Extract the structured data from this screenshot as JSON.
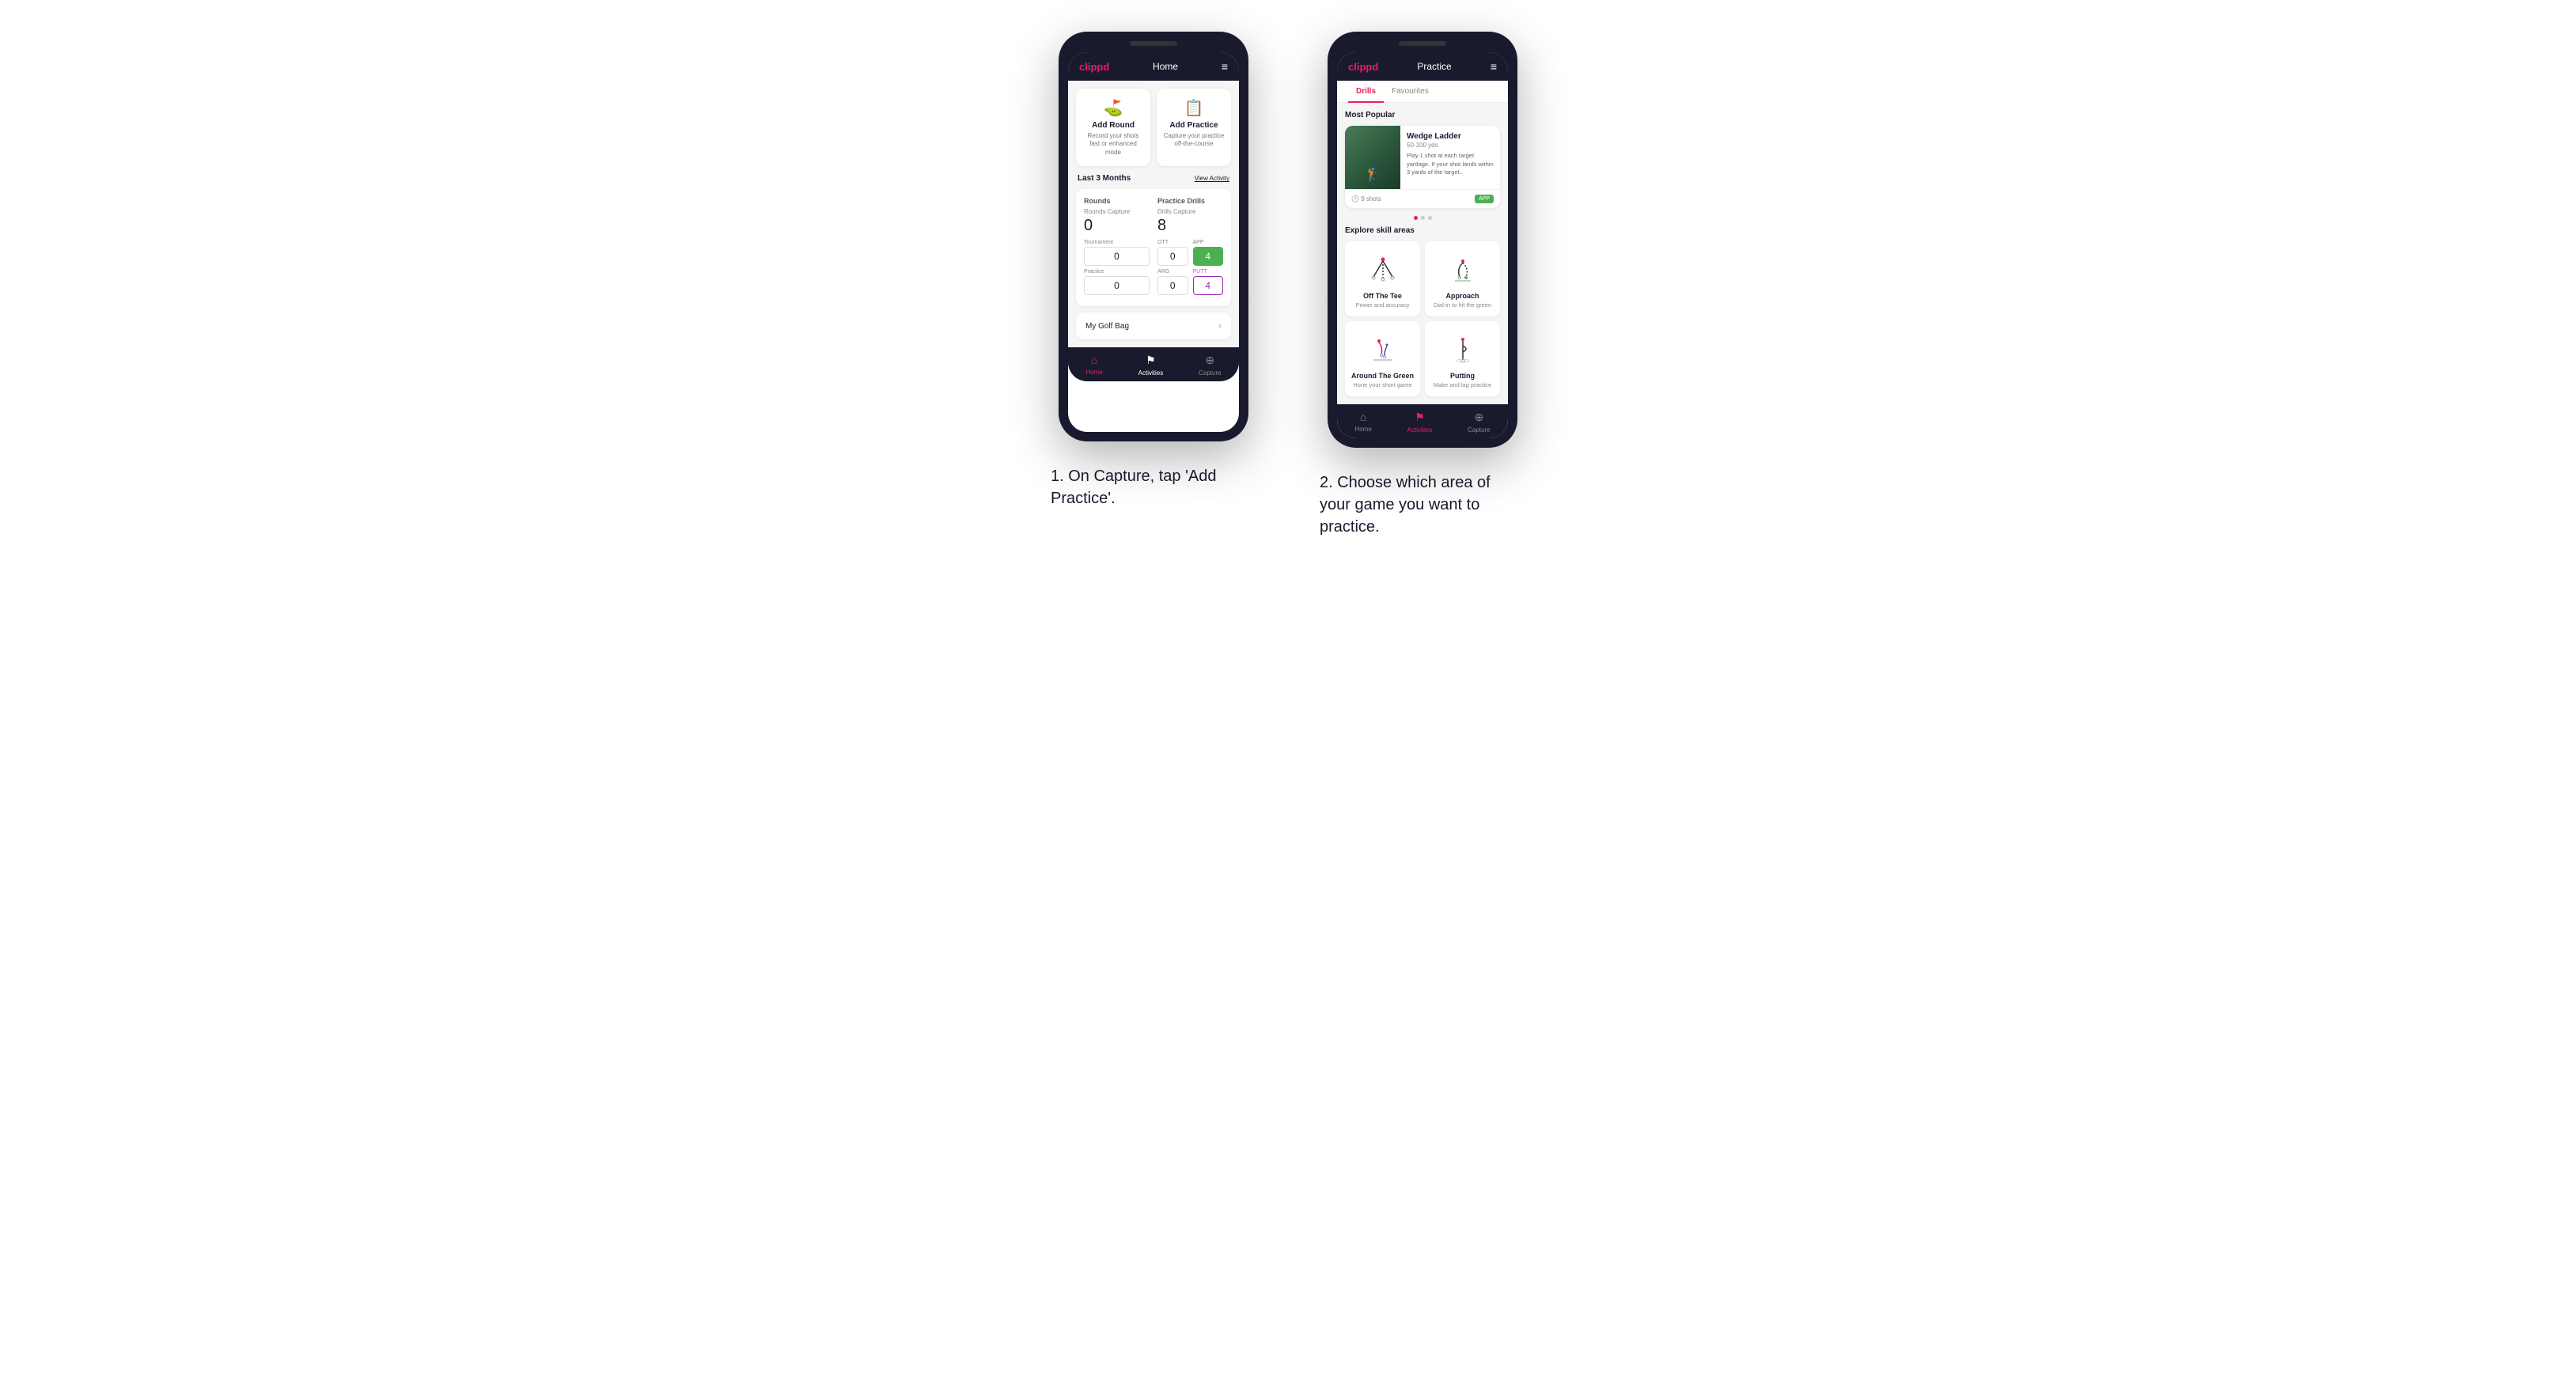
{
  "phone1": {
    "header": {
      "logo": "clippd",
      "title": "Home",
      "menu_icon": "≡"
    },
    "action_cards": [
      {
        "icon": "⛳",
        "title": "Add Round",
        "subtitle": "Record your shots fast or enhanced mode"
      },
      {
        "icon": "📋",
        "title": "Add Practice",
        "subtitle": "Capture your practice off-the-course"
      }
    ],
    "stats_section": {
      "period": "Last 3 Months",
      "view_link": "View Activity",
      "rounds": {
        "col_title": "Rounds",
        "capture_label": "Rounds Capture",
        "total": "0",
        "rows": [
          {
            "label": "Tournament",
            "value": "0"
          },
          {
            "label": "Practice",
            "value": "0"
          }
        ]
      },
      "practice_drills": {
        "col_title": "Practice Drills",
        "capture_label": "Drills Capture",
        "total": "8",
        "rows": [
          {
            "label": "OTT",
            "value": "0",
            "style": "normal"
          },
          {
            "label": "APP",
            "value": "4",
            "style": "green"
          },
          {
            "label": "ARG",
            "value": "0",
            "style": "normal"
          },
          {
            "label": "PUTT",
            "value": "4",
            "style": "purple"
          }
        ]
      }
    },
    "golf_bag": {
      "label": "My Golf Bag",
      "chevron": "›"
    },
    "bottom_nav": [
      {
        "icon": "🏠",
        "label": "Home",
        "active": true
      },
      {
        "icon": "📊",
        "label": "Activities",
        "active": false
      },
      {
        "icon": "➕",
        "label": "Capture",
        "active": false
      }
    ]
  },
  "phone2": {
    "header": {
      "logo": "clippd",
      "title": "Practice",
      "menu_icon": "≡"
    },
    "tabs": [
      {
        "label": "Drills",
        "active": true
      },
      {
        "label": "Favourites",
        "active": false
      }
    ],
    "most_popular": {
      "section_label": "Most Popular",
      "card": {
        "title": "Wedge Ladder",
        "yardage": "50-100 yds",
        "description": "Play 1 shot at each target yardage. If your shot lands within 3 yards of the target..",
        "shots": "9 shots",
        "badge": "APP"
      },
      "dots": [
        {
          "active": true
        },
        {
          "active": false
        },
        {
          "active": false
        }
      ]
    },
    "skill_areas": {
      "section_label": "Explore skill areas",
      "cards": [
        {
          "name": "Off The Tee",
          "description": "Power and accuracy"
        },
        {
          "name": "Approach",
          "description": "Dial-in to hit the green"
        },
        {
          "name": "Around The Green",
          "description": "Hone your short game"
        },
        {
          "name": "Putting",
          "description": "Make and lag practice"
        }
      ]
    },
    "bottom_nav": [
      {
        "icon": "🏠",
        "label": "Home",
        "active": false
      },
      {
        "icon": "📊",
        "label": "Activities",
        "active": true
      },
      {
        "icon": "➕",
        "label": "Capture",
        "active": false
      }
    ]
  },
  "captions": {
    "first": "1. On Capture, tap 'Add Practice'.",
    "second": "2. Choose which area of your game you want to practice."
  },
  "colors": {
    "accent": "#e91e63",
    "dark": "#1a1a2e",
    "green": "#4caf50",
    "purple": "#9c27b0"
  }
}
